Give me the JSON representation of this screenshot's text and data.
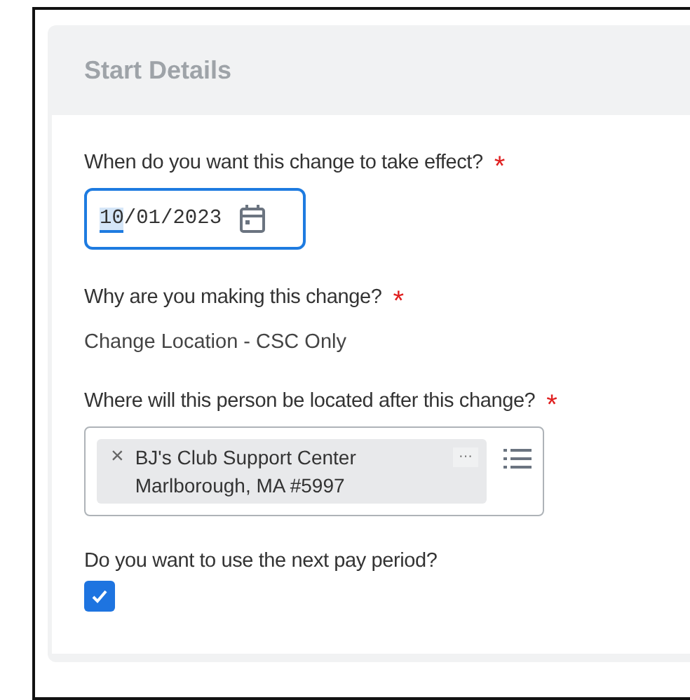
{
  "section": {
    "title": "Start Details"
  },
  "fields": [
    {
      "kind": "date",
      "label": "When do you want this change to take effect?",
      "required_mark": "*",
      "focused": true,
      "segments": [
        {
          "text": "10",
          "selected": true
        },
        {
          "text": "/01/2023",
          "selected": false
        }
      ]
    },
    {
      "kind": "text",
      "label": "Why are you making this change?",
      "required_mark": "*",
      "value": "Change Location - CSC Only"
    },
    {
      "kind": "multiselect",
      "label": "Where will this person be located after this change?",
      "required_mark": "*",
      "chips": [
        {
          "lines": [
            "BJ's Club Support Center",
            "Marlborough, MA #5997"
          ],
          "remove": "×",
          "more": "···"
        }
      ]
    },
    {
      "kind": "checkbox",
      "label": "Do you want to use the next pay period?",
      "checked": true
    }
  ]
}
